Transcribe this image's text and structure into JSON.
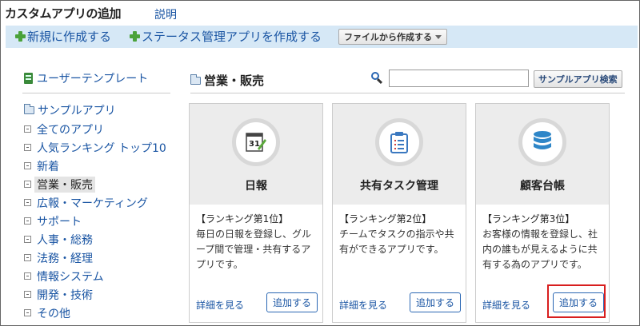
{
  "header": {
    "title": "カスタムアプリの追加",
    "help_label": "説明"
  },
  "toolbar": {
    "new_label": "新規に作成する",
    "status_label": "ステータス管理アプリを作成する",
    "file_label": "ファイルから作成する"
  },
  "sidebar": {
    "user_template_label": "ユーザーテンプレート",
    "sample_label": "サンプルアプリ",
    "categories": [
      {
        "label": "全てのアプリ"
      },
      {
        "label": "人気ランキング トップ10"
      },
      {
        "label": "新着"
      },
      {
        "label": "営業・販売"
      },
      {
        "label": "広報・マーケティング"
      },
      {
        "label": "サポート"
      },
      {
        "label": "人事・総務"
      },
      {
        "label": "法務・経理"
      },
      {
        "label": "情報システム"
      },
      {
        "label": "開発・技術"
      },
      {
        "label": "その他"
      }
    ]
  },
  "main": {
    "section_title": "営業・販売",
    "search_value": "",
    "search_button": "サンプルアプリ検索",
    "cards": [
      {
        "name": "日報",
        "rank": "【ランキング第1位】",
        "description": "毎日の日報を登録し、グループ間で管理・共有するアプリです。",
        "detail_label": "詳細を見る",
        "add_label": "追加する",
        "icon": "calendar-icon"
      },
      {
        "name": "共有タスク管理",
        "rank": "【ランキング第2位】",
        "description": "チームでタスクの指示や共有ができるアプリです。",
        "detail_label": "詳細を見る",
        "add_label": "追加する",
        "icon": "clipboard-icon"
      },
      {
        "name": "顧客台帳",
        "rank": "【ランキング第3位】",
        "description": "お客様の情報を登録し、社内の誰もが見えるように共有する為のアプリです。",
        "detail_label": "詳細を見る",
        "add_label": "追加する",
        "icon": "database-icon"
      }
    ]
  },
  "colors": {
    "link": "#1a55a3",
    "toolbar_bg": "#d6e8f6",
    "highlight": "#d81e1e",
    "plus": "#4aa23a"
  },
  "calendar_number": "31"
}
